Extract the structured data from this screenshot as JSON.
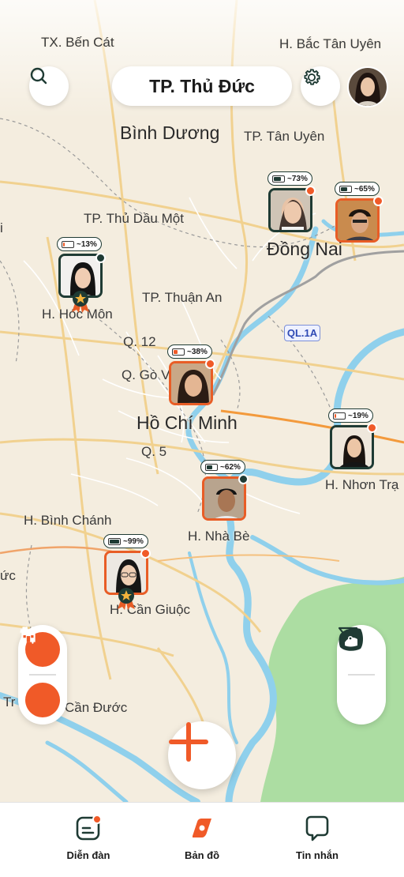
{
  "header": {
    "location": "TP. Thủ Đức"
  },
  "map_labels": [
    {
      "id": "tx-ben-cat",
      "text": "TX. Bến Cát"
    },
    {
      "id": "h-bac-tan-uyen",
      "text": "H. Bắc Tân Uyên"
    },
    {
      "id": "binh-duong",
      "text": "Bình Dương"
    },
    {
      "id": "tp-tan-uyen",
      "text": "TP. Tân Uyên"
    },
    {
      "id": "tp-thu-dau-mot",
      "text": "TP. Thủ Dầu Một"
    },
    {
      "id": "dong-nai",
      "text": "Đồng Nai"
    },
    {
      "id": "h-hoc-mon",
      "text": "H. Hóc Môn"
    },
    {
      "id": "tp-thuan-an",
      "text": "TP. Thuận An"
    },
    {
      "id": "q12",
      "text": "Q. 12"
    },
    {
      "id": "q-go-vap",
      "text": "Q. Gò Vấ"
    },
    {
      "id": "ho-chi-minh",
      "text": "Hồ Chí Minh"
    },
    {
      "id": "q5",
      "text": "Q. 5"
    },
    {
      "id": "h-nhon-trach",
      "text": "H. Nhơn Trạ"
    },
    {
      "id": "h-binh-chanh",
      "text": "H. Bình Chánh"
    },
    {
      "id": "h-nha-be",
      "text": "H. Nhà Bè"
    },
    {
      "id": "h-can-giuoc",
      "text": "H. Cần Giuộc"
    },
    {
      "id": "can-duoc",
      "text": "Cần Đước"
    },
    {
      "id": "edge-i",
      "text": "i"
    },
    {
      "id": "edge-rc",
      "text": "ức"
    },
    {
      "id": "edge-tr",
      "text": "Tr"
    }
  ],
  "road_shield": "QL.1A",
  "friends": [
    {
      "battery": "~73%",
      "level": 0.73,
      "frame": "dark",
      "dot": "#f05a28",
      "badge": false
    },
    {
      "battery": "~65%",
      "level": 0.65,
      "frame": "orange",
      "dot": "#f05a28",
      "badge": false
    },
    {
      "battery": "~13%",
      "level": 0.13,
      "frame": "dark",
      "dot": "#1f3b34",
      "badge": true
    },
    {
      "battery": "~38%",
      "level": 0.38,
      "frame": "orange",
      "dot": "#f05a28",
      "badge": false
    },
    {
      "battery": "~19%",
      "level": 0.19,
      "frame": "dark",
      "dot": "#f05a28",
      "badge": false
    },
    {
      "battery": "~62%",
      "level": 0.62,
      "frame": "orange",
      "dot": "#1f3b34",
      "badge": false
    },
    {
      "battery": "~99%",
      "level": 0.99,
      "frame": "orange",
      "dot": "#f05a28",
      "badge": true
    }
  ],
  "left_tools": [
    "fork-knife-icon",
    "store-icon"
  ],
  "right_tools": [
    "filter-crown-icon",
    "map-pin-icon"
  ],
  "nav": {
    "forum_label": "Diễn đàn",
    "map_label": "Bản đồ",
    "messages_label": "Tin nhắn"
  },
  "colors": {
    "accent": "#f05a28",
    "dark": "#1f3b34",
    "water": "#8fd0ec",
    "green": "#a8dca0"
  }
}
